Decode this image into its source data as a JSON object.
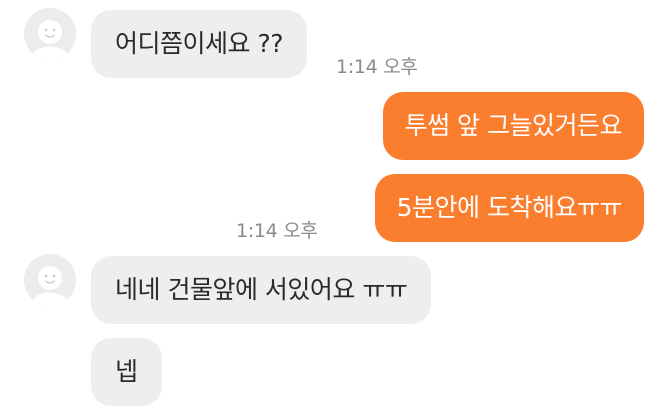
{
  "conversation": {
    "messages": [
      {
        "sender": "other",
        "text": "어디쯤이세요 ??"
      },
      {
        "sender": "me",
        "text": "투썸 앞 그늘있거든요"
      },
      {
        "sender": "me",
        "text": "5분안에 도착해요ㅠㅠ"
      },
      {
        "sender": "other",
        "text": "네네 건물앞에 서있어요 ㅠㅠ"
      },
      {
        "sender": "other",
        "text": "넵"
      }
    ],
    "timestamps": [
      "1:14 오후",
      "1:14 오후"
    ]
  },
  "colors": {
    "outgoing_bubble": "#fb7d2e",
    "incoming_bubble": "#eeeef0",
    "timestamp_text": "#8a8a8a",
    "avatar_bg": "#ececee"
  },
  "icons": {
    "avatar": "default-profile-avatar-icon"
  }
}
